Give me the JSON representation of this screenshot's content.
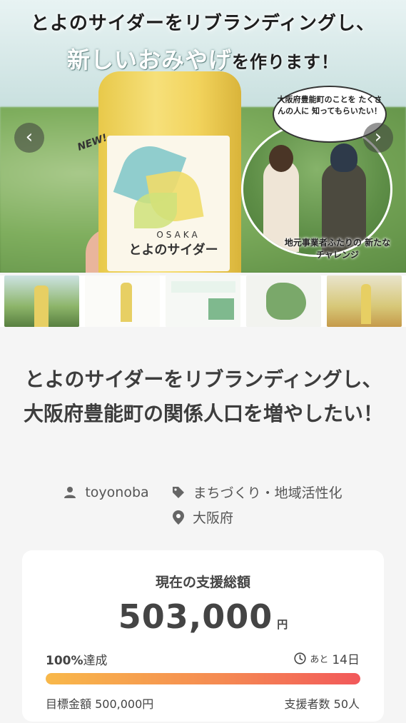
{
  "hero": {
    "headline_line1": "とよのサイダーをリブランディングし、",
    "headline_line2_a": "新しいおみやげ",
    "headline_line2_b": "を作ります！",
    "new_tag": "NEW!",
    "bottle_osaka": "OSAKA",
    "bottle_name": "とよのサイダー",
    "bubble_text": "大阪府豊能町のことを たくさんの人に 知ってもらいたい！",
    "caption": "地元事業者ふたりの 新たなチャレンジ"
  },
  "carousel": {
    "prev_icon": "chevron-left-icon",
    "next_icon": "chevron-right-icon",
    "thumbnail_count": 5
  },
  "project": {
    "title": "とよのサイダーをリブランディングし、大阪府豊能町の関係人口を増やしたい！",
    "owner": "toyonoba",
    "category": "まちづくり・地域活性化",
    "location": "大阪府"
  },
  "funding": {
    "label": "現在の支援総額",
    "amount": "503,000",
    "unit": "円",
    "achievement_pct": "100%",
    "achievement_suffix": "達成",
    "remaining_prefix": "あと",
    "remaining_days": "14日",
    "progress": 1.0,
    "goal_text": "目標金額 500,000円",
    "backers_text": "支援者数 50人"
  },
  "colors": {
    "progress_start": "#f8b84a",
    "progress_end": "#f2585a",
    "text_main": "#3d3d3d"
  }
}
